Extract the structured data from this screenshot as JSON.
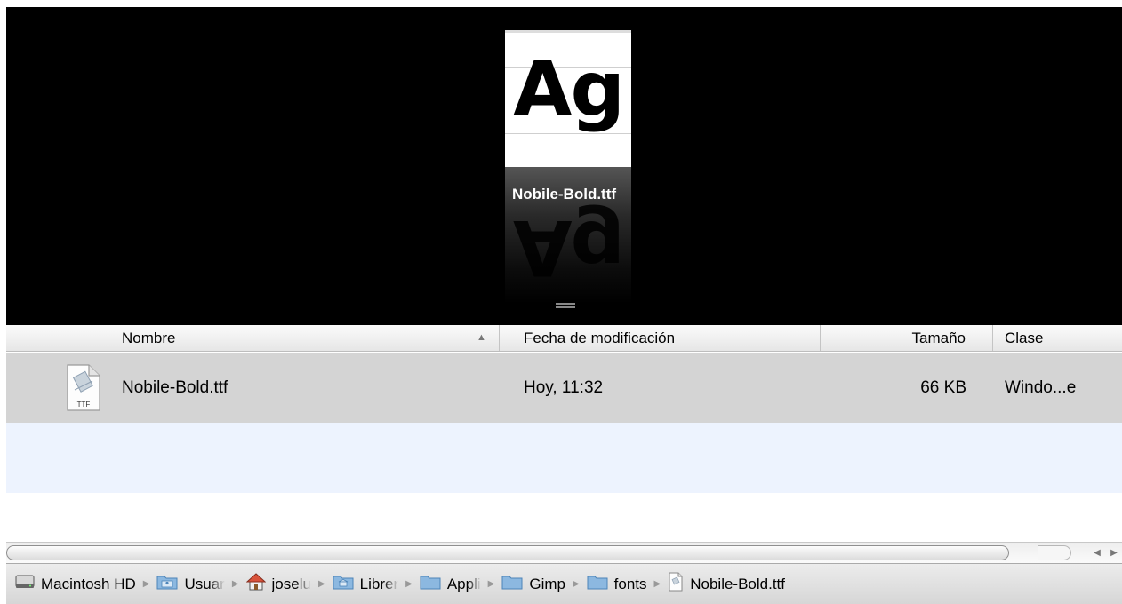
{
  "coverflow": {
    "preview_glyph": "Ag",
    "selected_file_caption": "Nobile-Bold.ttf"
  },
  "columns": {
    "name": "Nombre",
    "date_modified": "Fecha de modificación",
    "size": "Tamaño",
    "kind": "Clase"
  },
  "files": [
    {
      "name": "Nobile-Bold.ttf",
      "date_modified": "Hoy, 11:32",
      "size": "66 KB",
      "kind": "Windo...e",
      "icon_label": "TTF",
      "icon": "ttf-font-file-icon"
    }
  ],
  "path_bar": [
    {
      "label": "Macintosh HD",
      "icon": "hard-drive-icon"
    },
    {
      "label": "Usuar",
      "icon": "users-folder-icon"
    },
    {
      "label": "joselu",
      "icon": "home-icon"
    },
    {
      "label": "Librer",
      "icon": "library-folder-icon"
    },
    {
      "label": "Appli",
      "icon": "folder-icon"
    },
    {
      "label": "Gimp",
      "icon": "folder-icon"
    },
    {
      "label": "fonts",
      "icon": "folder-icon"
    },
    {
      "label": "Nobile-Bold.ttf",
      "icon": "document-icon"
    }
  ],
  "colors": {
    "coverflow_bg": "#000000",
    "selected_row_bg": "#d4d4d4",
    "alternate_row_bg": "#edf3fe"
  }
}
